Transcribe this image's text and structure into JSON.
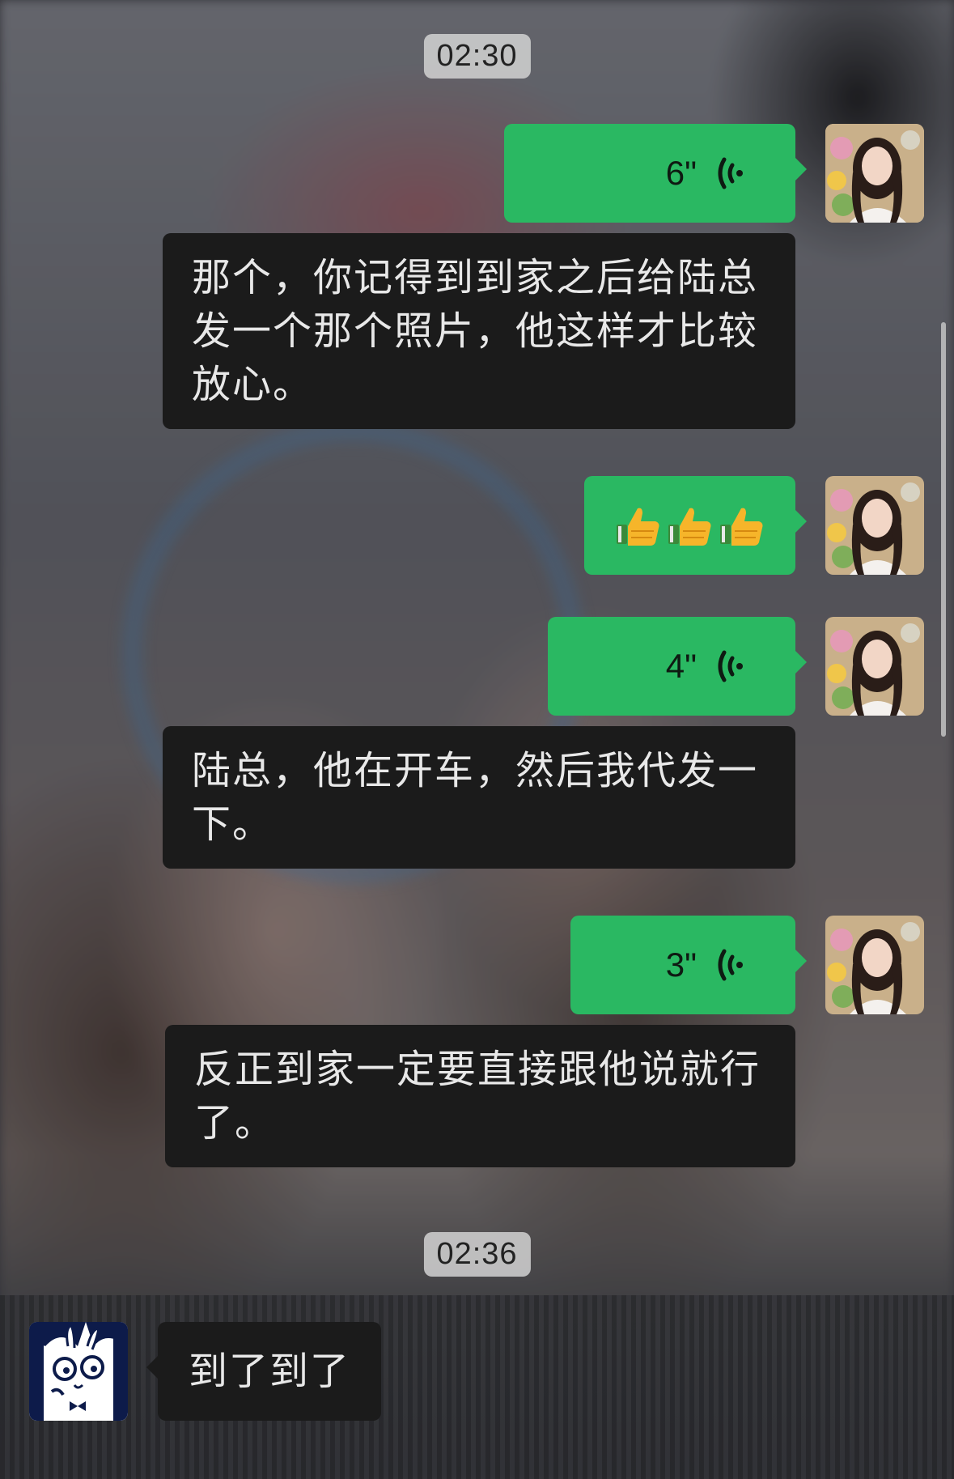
{
  "timestamps": [
    "02:30",
    "02:36"
  ],
  "messages": [
    {
      "type": "voice",
      "side": "self",
      "duration": "6\""
    },
    {
      "type": "text",
      "side": "self",
      "text": "那个，你记得到到家之后给陆总发一个那个照片，他这样才比较放心。"
    },
    {
      "type": "emoji",
      "side": "self",
      "emojis": [
        "👍",
        "👍",
        "👍"
      ],
      "icon": "thumbs-up-icon"
    },
    {
      "type": "voice",
      "side": "self",
      "duration": "4\""
    },
    {
      "type": "text",
      "side": "self",
      "text": "陆总，他在开车，然后我代发一下。"
    },
    {
      "type": "voice",
      "side": "self",
      "duration": "3\""
    },
    {
      "type": "text",
      "side": "self",
      "text": "反正到家一定要直接跟他说就行了。"
    },
    {
      "type": "text",
      "side": "other",
      "text": "到了到了"
    }
  ],
  "colors": {
    "self_bubble": "#2ab862",
    "dark_bubble": "#1b1b1b",
    "timestamp_bg": "#d2d2d2"
  },
  "avatars": {
    "self": "girl-photo-avatar",
    "other": "cartoon-rabbit-avatar"
  }
}
